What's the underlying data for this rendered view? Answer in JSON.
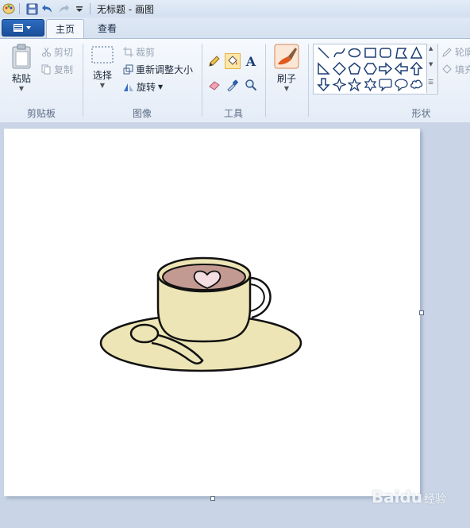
{
  "window": {
    "title": "无标题 - 画图"
  },
  "tabs": [
    {
      "label": "主页",
      "active": true
    },
    {
      "label": "查看",
      "active": false
    }
  ],
  "clipboard": {
    "paste": "粘贴",
    "cut": "剪切",
    "copy": "复制",
    "group": "剪贴板"
  },
  "image": {
    "select": "选择",
    "crop": "裁剪",
    "resize": "重新调整大小",
    "rotate": "旋转",
    "group": "图像"
  },
  "tools": {
    "text_tool": "A",
    "group": "工具"
  },
  "brushes": {
    "label": "刷子"
  },
  "shapes": {
    "group": "形状",
    "outline": "轮廓",
    "fill": "填充",
    "items": [
      "line-icon",
      "curve-icon",
      "oval-icon",
      "rectangle-icon",
      "rounded-rectangle-icon",
      "polygon-icon",
      "triangle-icon",
      "right-triangle-icon",
      "diamond-icon",
      "pentagon-icon",
      "hexagon-icon",
      "right-arrow-icon",
      "left-arrow-icon",
      "up-arrow-icon",
      "down-arrow-icon",
      "four-point-star-icon",
      "five-point-star-icon",
      "six-point-star-icon",
      "rounded-callout-icon",
      "oval-callout-icon",
      "cloud-callout-icon"
    ]
  },
  "watermark": {
    "brand": "Baidu",
    "suffix": "经验"
  },
  "colors": {
    "cup_fill": "#ede5b5",
    "coffee_fill": "#c39a92",
    "heart_fill": "#f3dde0",
    "outline": "#111111",
    "accent_blue": "#1a4e9a"
  }
}
